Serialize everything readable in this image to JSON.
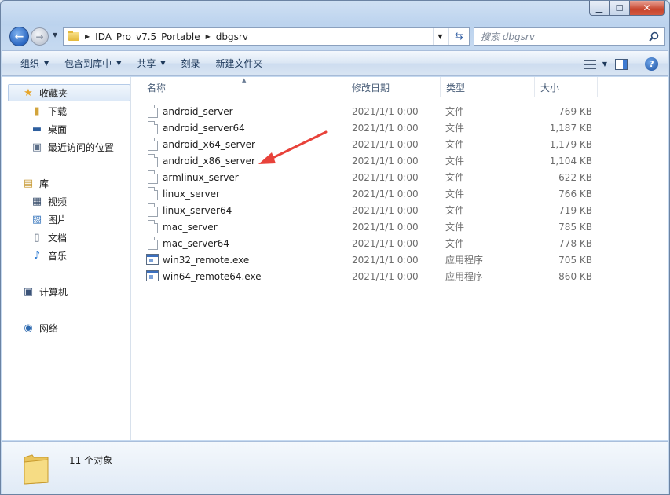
{
  "breadcrumb": [
    "IDA_Pro_v7.5_Portable",
    "dbgsrv"
  ],
  "search": {
    "placeholder": "搜索 dbgsrv"
  },
  "toolbar": {
    "organize": "组织",
    "include_in_library": "包含到库中",
    "share": "共享",
    "burn": "刻录",
    "new_folder": "新建文件夹"
  },
  "nav": {
    "favorites": "收藏夹",
    "downloads": "下载",
    "desktop": "桌面",
    "recent": "最近访问的位置",
    "libraries": "库",
    "videos": "视频",
    "pictures": "图片",
    "documents": "文档",
    "music": "音乐",
    "computer": "计算机",
    "network": "网络"
  },
  "columns": {
    "name": "名称",
    "date": "修改日期",
    "type": "类型",
    "size": "大小"
  },
  "files": [
    {
      "name": "android_server",
      "date": "2021/1/1 0:00",
      "type": "文件",
      "size": "769 KB",
      "icon": "file-icon"
    },
    {
      "name": "android_server64",
      "date": "2021/1/1 0:00",
      "type": "文件",
      "size": "1,187 KB",
      "icon": "file-icon"
    },
    {
      "name": "android_x64_server",
      "date": "2021/1/1 0:00",
      "type": "文件",
      "size": "1,179 KB",
      "icon": "file-icon"
    },
    {
      "name": "android_x86_server",
      "date": "2021/1/1 0:00",
      "type": "文件",
      "size": "1,104 KB",
      "icon": "file-icon"
    },
    {
      "name": "armlinux_server",
      "date": "2021/1/1 0:00",
      "type": "文件",
      "size": "622 KB",
      "icon": "file-icon"
    },
    {
      "name": "linux_server",
      "date": "2021/1/1 0:00",
      "type": "文件",
      "size": "766 KB",
      "icon": "file-icon"
    },
    {
      "name": "linux_server64",
      "date": "2021/1/1 0:00",
      "type": "文件",
      "size": "719 KB",
      "icon": "file-icon"
    },
    {
      "name": "mac_server",
      "date": "2021/1/1 0:00",
      "type": "文件",
      "size": "785 KB",
      "icon": "file-icon"
    },
    {
      "name": "mac_server64",
      "date": "2021/1/1 0:00",
      "type": "文件",
      "size": "778 KB",
      "icon": "file-icon"
    },
    {
      "name": "win32_remote.exe",
      "date": "2021/1/1 0:00",
      "type": "应用程序",
      "size": "705 KB",
      "icon": "exe-icon"
    },
    {
      "name": "win64_remote64.exe",
      "date": "2021/1/1 0:00",
      "type": "应用程序",
      "size": "860 KB",
      "icon": "exe-icon"
    }
  ],
  "status": {
    "count": "11 个对象"
  },
  "colors": {
    "annotation_arrow": "#e8423a",
    "accent": "#3b6fbf"
  }
}
